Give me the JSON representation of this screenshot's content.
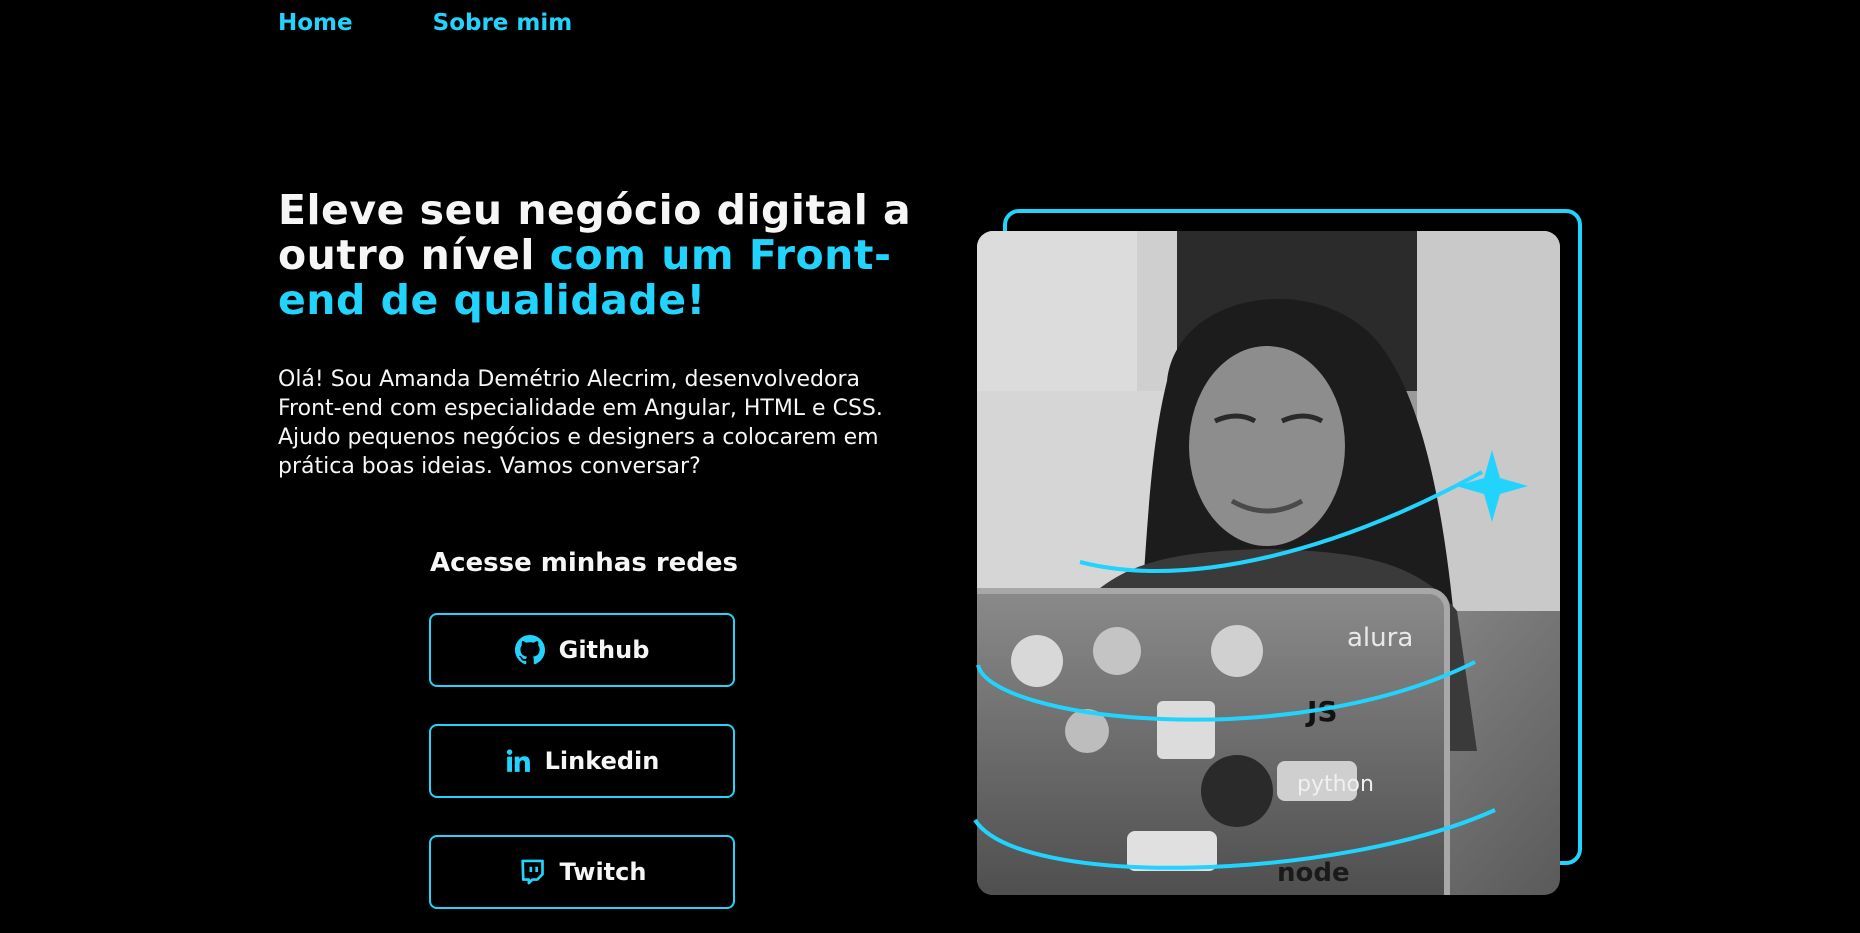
{
  "nav": {
    "home": "Home",
    "about": "Sobre mim"
  },
  "hero": {
    "title_part1": "Eleve seu negócio digital a outro nível ",
    "title_accent": "com um Front-end de qualidade!",
    "intro": "Olá! Sou Amanda Demétrio Alecrim, desenvolvedora Front-end com especialidade em Angular, HTML e CSS. Ajudo pequenos negócios e designers a colocarem em prática boas ideias. Vamos conversar?"
  },
  "social": {
    "heading": "Acesse minhas redes",
    "buttons": [
      {
        "label": "Github",
        "icon": "github-icon"
      },
      {
        "label": "Linkedin",
        "icon": "linkedin-icon"
      },
      {
        "label": "Twitch",
        "icon": "twitch-icon"
      }
    ]
  },
  "laptop_stickers": {
    "sticker_1": "alura",
    "sticker_2": "JS",
    "sticker_3": "python",
    "sticker_4": "node"
  },
  "colors": {
    "background": "#000000",
    "accent": "#22d4fd",
    "text": "#f6f6f6"
  }
}
